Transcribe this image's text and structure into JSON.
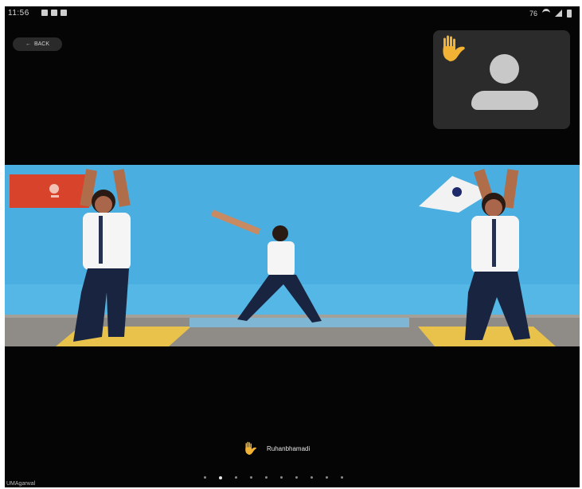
{
  "status_bar": {
    "time": "11:56",
    "right_text": "76"
  },
  "controls": {
    "back_label": "BACK"
  },
  "self_view": {
    "hand_raised_icon": "raise-hand-icon",
    "avatar_icon": "avatar-placeholder-icon"
  },
  "speaker": {
    "name": "Ruhanbhamadi",
    "icon": "raise-hand-icon"
  },
  "footer": {
    "label": "UMAgarwal"
  },
  "pagination": {
    "count": 10,
    "active_index": 1
  },
  "colors": {
    "background": "#050505",
    "tile": "#2b2b2b",
    "hand": "#f2b233",
    "wall": "#4aaee0",
    "mat": "#e8c24a",
    "red_sign": "#d8432c"
  }
}
